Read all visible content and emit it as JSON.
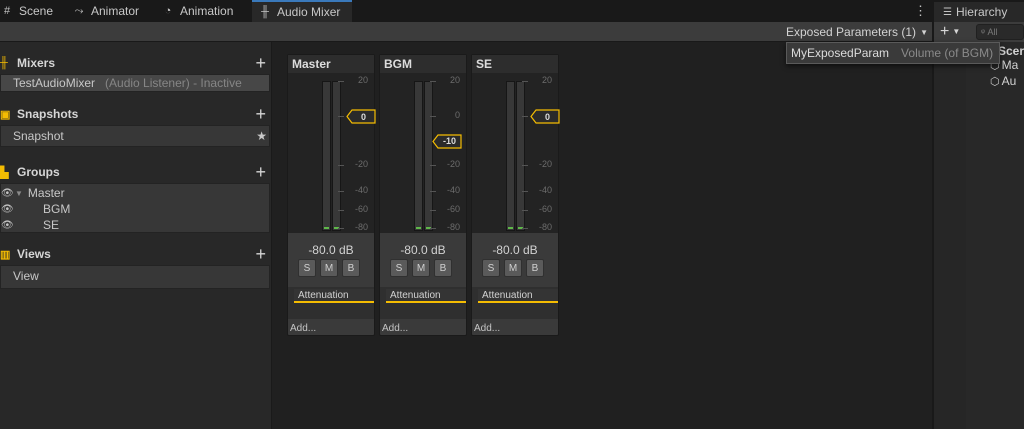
{
  "tabs": [
    {
      "label": "Scene",
      "icon": "grid-icon"
    },
    {
      "label": "Animator",
      "icon": "animator-icon"
    },
    {
      "label": "Animation",
      "icon": "animation-clock-icon"
    },
    {
      "label": "Audio Mixer",
      "icon": "audio-mixer-icon"
    }
  ],
  "hierarchy": {
    "tab_label": "Hierarchy",
    "search_placeholder": "All",
    "items": [
      "Scer",
      "Ma",
      "Au"
    ]
  },
  "toolbar": {
    "exposed_label": "Exposed Parameters (1)"
  },
  "popup": {
    "param_name": "MyExposedParam",
    "param_desc": "Volume (of BGM)"
  },
  "sections": {
    "mixers": {
      "title": "Mixers",
      "item": "TestAudioMixer",
      "item_detail": "(Audio Listener) - Inactive"
    },
    "snapshots": {
      "title": "Snapshots",
      "item": "Snapshot"
    },
    "groups": {
      "title": "Groups",
      "items": [
        "Master",
        "BGM",
        "SE"
      ]
    },
    "views": {
      "title": "Views",
      "item": "View"
    }
  },
  "scale_labels": [
    "20",
    "0",
    "-20",
    "-40",
    "-60",
    "-80"
  ],
  "strips": [
    {
      "name": "Master",
      "fader_db": "0",
      "db": "-80.0 dB",
      "effect": "Attenuation",
      "add": "Add..."
    },
    {
      "name": "BGM",
      "fader_db": "-10",
      "db": "-80.0 dB",
      "effect": "Attenuation",
      "add": "Add..."
    },
    {
      "name": "SE",
      "fader_db": "0",
      "db": "-80.0 dB",
      "effect": "Attenuation",
      "add": "Add..."
    }
  ],
  "strip_buttons": [
    "S",
    "M",
    "B"
  ],
  "colors": {
    "accent": "#f4bc02",
    "meter": "#5fb84a",
    "active_tab": "#3a79bb"
  }
}
